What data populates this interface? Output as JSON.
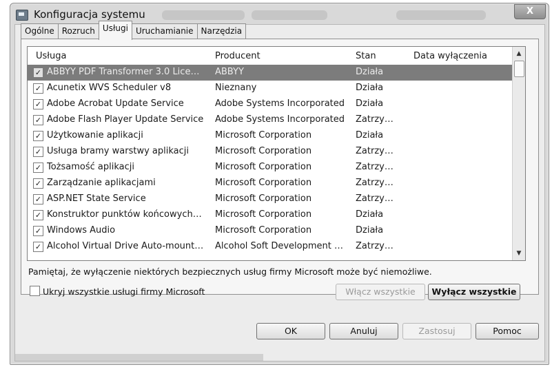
{
  "window": {
    "title": "Konfiguracja systemu",
    "close_label": "X"
  },
  "tabs": [
    {
      "label": "Ogólne"
    },
    {
      "label": "Rozruch"
    },
    {
      "label": "Usługi"
    },
    {
      "label": "Uruchamianie"
    },
    {
      "label": "Narzędzia"
    }
  ],
  "services": {
    "columns": {
      "service": "Usługa",
      "vendor": "Producent",
      "status": "Stan",
      "disabled_date": "Data wyłączenia"
    },
    "rows": [
      {
        "name": "ABBYY PDF Transformer 3.0 Lice…",
        "vendor": "ABBYY",
        "status": "Działa",
        "checked": true,
        "selected": true
      },
      {
        "name": "Acunetix WVS Scheduler v8",
        "vendor": "Nieznany",
        "status": "Działa",
        "checked": true
      },
      {
        "name": "Adobe Acrobat Update Service",
        "vendor": "Adobe Systems Incorporated",
        "status": "Działa",
        "checked": true
      },
      {
        "name": "Adobe Flash Player Update Service",
        "vendor": "Adobe Systems Incorporated",
        "status": "Zatrzy…",
        "checked": true
      },
      {
        "name": "Użytkowanie aplikacji",
        "vendor": "Microsoft Corporation",
        "status": "Działa",
        "checked": true
      },
      {
        "name": "Usługa bramy warstwy aplikacji",
        "vendor": "Microsoft Corporation",
        "status": "Zatrzy…",
        "checked": true
      },
      {
        "name": "Tożsamość aplikacji",
        "vendor": "Microsoft Corporation",
        "status": "Zatrzy…",
        "checked": true
      },
      {
        "name": "Zarządzanie aplikacjami",
        "vendor": "Microsoft Corporation",
        "status": "Zatrzy…",
        "checked": true
      },
      {
        "name": "ASP.NET State Service",
        "vendor": "Microsoft Corporation",
        "status": "Zatrzy…",
        "checked": true
      },
      {
        "name": "Konstruktor punktów końcowych…",
        "vendor": "Microsoft Corporation",
        "status": "Działa",
        "checked": true
      },
      {
        "name": "Windows Audio",
        "vendor": "Microsoft Corporation",
        "status": "Działa",
        "checked": true
      },
      {
        "name": "Alcohol Virtual Drive Auto-mount…",
        "vendor": "Alcohol Soft Development …",
        "status": "Zatrzy…",
        "checked": true
      }
    ]
  },
  "note": "Pamiętaj, że wyłączenie niektórych bezpiecznych usług firmy Microsoft może być niemożliwe.",
  "hide_ms_label": "Ukryj wszystkie usługi firmy Microsoft",
  "buttons": {
    "enable_all": "Włącz wszystkie",
    "disable_all": "Wyłącz wszystkie",
    "ok": "OK",
    "cancel": "Anuluj",
    "apply": "Zastosuj",
    "help": "Pomoc"
  }
}
